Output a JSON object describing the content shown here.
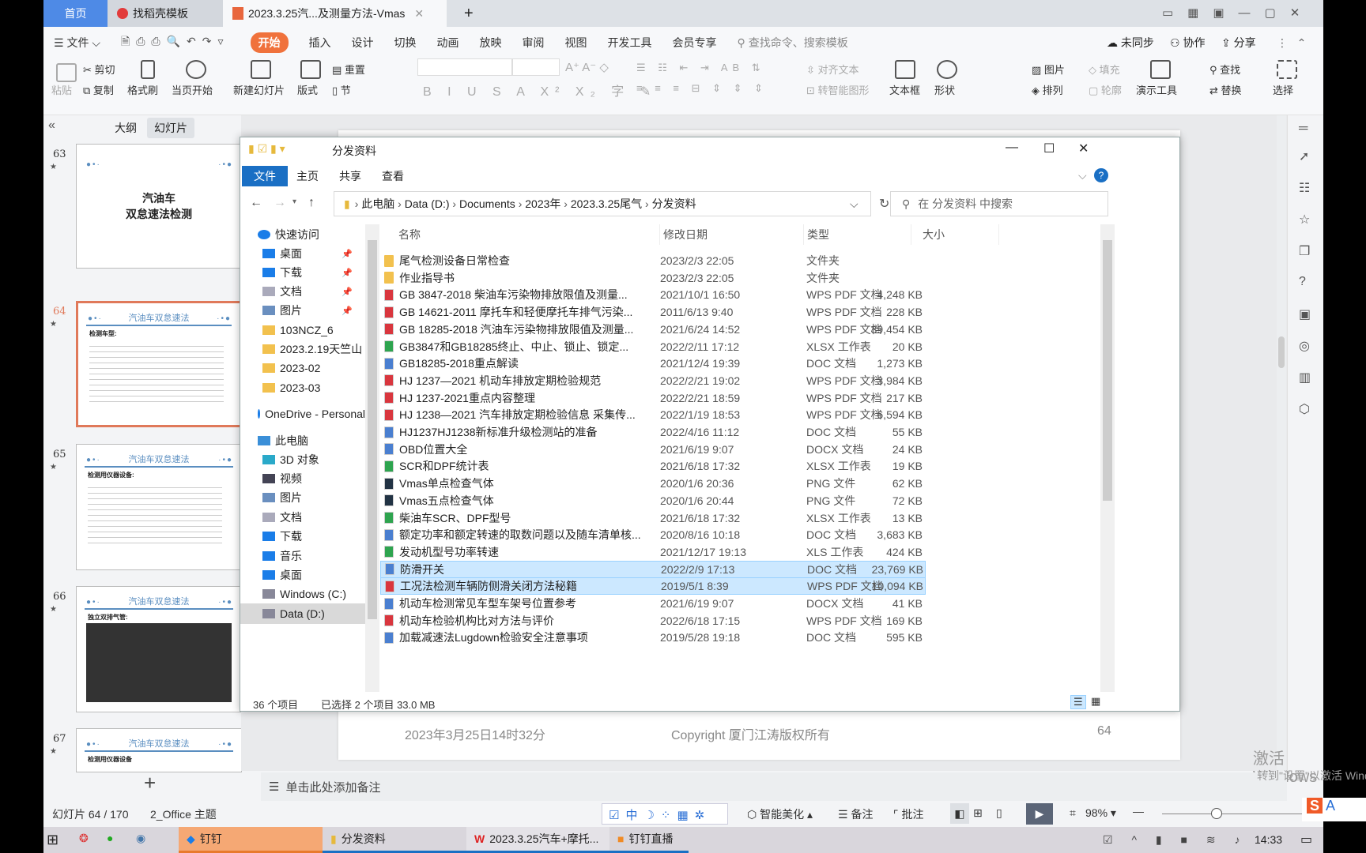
{
  "wps": {
    "tabs": [
      {
        "label": "首页"
      },
      {
        "label": "找稻壳模板"
      },
      {
        "label": "2023.3.25汽...及测量方法-Vmas"
      }
    ],
    "new_tab": "+",
    "menu": {
      "file": "文件",
      "items": [
        "开始",
        "插入",
        "设计",
        "切换",
        "动画",
        "放映",
        "审阅",
        "视图",
        "开发工具",
        "会员专享"
      ],
      "search": "查找命令、搜索模板",
      "sync": "未同步",
      "collab": "协作",
      "share": "分享"
    },
    "ribbon": {
      "paste": "粘贴",
      "cut": "剪切",
      "copy": "复制",
      "format_painter": "格式刷",
      "play_from_current": "当页开始",
      "new_slide": "新建幻灯片",
      "layout": "版式",
      "reset": "重置",
      "section": "节",
      "align_text": "对齐文本",
      "smart_graphic": "转智能图形",
      "textbox": "文本框",
      "shape": "形状",
      "picture": "图片",
      "arrange": "排列",
      "fill": "填充",
      "outline": "轮廓",
      "presenter_tools": "演示工具",
      "find": "查找",
      "replace": "替换",
      "select": "选择"
    },
    "panel": {
      "outline_tab": "大纲",
      "slides_tab": "幻灯片",
      "add": "+"
    },
    "thumbs": [
      {
        "num": "63",
        "title_line1": "汽油车",
        "title_line2": "双怠速法检测"
      },
      {
        "num": "64",
        "title": "汽油车双怠速法",
        "sub": "检测车型:"
      },
      {
        "num": "65",
        "title": "汽油车双怠速法",
        "sub": "检测用仪器设备:"
      },
      {
        "num": "66",
        "title": "汽油车双怠速法",
        "sub": "独立双排气管:"
      },
      {
        "num": "67",
        "title": "汽油车双怠速法",
        "sub": "检测用仪器设备"
      }
    ],
    "slide": {
      "date": "2023年3月25日14时32分",
      "copyright": "Copyright 厦门江涛版权所有",
      "page": "64"
    },
    "notes_placeholder": "单击此处添加备注",
    "status": {
      "slide_count": "幻灯片 64 / 170",
      "theme": "2_Office 主题",
      "beautify": "智能美化",
      "notes": "备注",
      "comments": "批注",
      "zoom": "98%"
    },
    "watermark": {
      "line1": "激活 Windows",
      "line2": "转到\"设置\"以激活 Windows。"
    }
  },
  "explorer": {
    "title": "分发资料",
    "tabs": [
      "文件",
      "主页",
      "共享",
      "查看"
    ],
    "breadcrumb": [
      "此电脑",
      "Data (D:)",
      "Documents",
      "2023年",
      "2023.3.25尾气",
      "分发资料"
    ],
    "search_placeholder": "在 分发资料 中搜索",
    "nav": [
      {
        "label": "快速访问",
        "icon": "star",
        "level": 0
      },
      {
        "label": "桌面",
        "icon": "desktop",
        "level": 1,
        "pinned": true
      },
      {
        "label": "下载",
        "icon": "download",
        "level": 1,
        "pinned": true
      },
      {
        "label": "文档",
        "icon": "document",
        "level": 1,
        "pinned": true
      },
      {
        "label": "图片",
        "icon": "picture",
        "level": 1,
        "pinned": true
      },
      {
        "label": "103NCZ_6",
        "icon": "folder",
        "level": 1
      },
      {
        "label": "2023.2.19天竺山",
        "icon": "folder",
        "level": 1
      },
      {
        "label": "2023-02",
        "icon": "folder",
        "level": 1
      },
      {
        "label": "2023-03",
        "icon": "folder",
        "level": 1
      },
      {
        "label": "OneDrive - Personal",
        "icon": "cloud",
        "level": 0
      },
      {
        "label": "此电脑",
        "icon": "computer",
        "level": 0
      },
      {
        "label": "3D 对象",
        "icon": "cube",
        "level": 1
      },
      {
        "label": "视频",
        "icon": "video",
        "level": 1
      },
      {
        "label": "图片",
        "icon": "picture",
        "level": 1
      },
      {
        "label": "文档",
        "icon": "document",
        "level": 1
      },
      {
        "label": "下载",
        "icon": "download",
        "level": 1
      },
      {
        "label": "音乐",
        "icon": "music",
        "level": 1
      },
      {
        "label": "桌面",
        "icon": "desktop",
        "level": 1
      },
      {
        "label": "Windows (C:)",
        "icon": "drive",
        "level": 1
      },
      {
        "label": "Data (D:)",
        "icon": "drive",
        "level": 1,
        "selected": true
      }
    ],
    "columns": [
      "名称",
      "修改日期",
      "类型",
      "大小"
    ],
    "files": [
      {
        "name": "尾气检测设备日常检查",
        "date": "2023/2/3 22:05",
        "type": "文件夹",
        "size": "",
        "kind": "folder"
      },
      {
        "name": "作业指导书",
        "date": "2023/2/3 22:05",
        "type": "文件夹",
        "size": "",
        "kind": "folder"
      },
      {
        "name": "GB 3847-2018 柴油车污染物排放限值及测量...",
        "date": "2021/10/1 16:50",
        "type": "WPS PDF 文档",
        "size": "4,248 KB",
        "kind": "pdf"
      },
      {
        "name": "GB 14621-2011 摩托车和轻便摩托车排气污染...",
        "date": "2011/6/13 9:40",
        "type": "WPS PDF 文档",
        "size": "228 KB",
        "kind": "pdf"
      },
      {
        "name": "GB 18285-2018 汽油车污染物排放限值及测量...",
        "date": "2021/6/24 14:52",
        "type": "WPS PDF 文档",
        "size": "39,454 KB",
        "kind": "pdf"
      },
      {
        "name": "GB3847和GB18285终止、中止、锁止、锁定...",
        "date": "2022/2/11 17:12",
        "type": "XLSX 工作表",
        "size": "20 KB",
        "kind": "xlsx"
      },
      {
        "name": "GB18285-2018重点解读",
        "date": "2021/12/4 19:39",
        "type": "DOC 文档",
        "size": "1,273 KB",
        "kind": "doc"
      },
      {
        "name": "HJ 1237—2021 机动车排放定期检验规范",
        "date": "2022/2/21 19:02",
        "type": "WPS PDF 文档",
        "size": "3,984 KB",
        "kind": "pdf"
      },
      {
        "name": "HJ 1237-2021重点内容整理",
        "date": "2022/2/21 18:59",
        "type": "WPS PDF 文档",
        "size": "217 KB",
        "kind": "pdf"
      },
      {
        "name": "HJ 1238—2021 汽车排放定期检验信息 采集传...",
        "date": "2022/1/19 18:53",
        "type": "WPS PDF 文档",
        "size": "6,594 KB",
        "kind": "pdf"
      },
      {
        "name": "HJ1237HJ1238新标准升级检测站的准备",
        "date": "2022/4/16 11:12",
        "type": "DOC 文档",
        "size": "55 KB",
        "kind": "doc"
      },
      {
        "name": "OBD位置大全",
        "date": "2021/6/19 9:07",
        "type": "DOCX 文档",
        "size": "24 KB",
        "kind": "docx"
      },
      {
        "name": "SCR和DPF统计表",
        "date": "2021/6/18 17:32",
        "type": "XLSX 工作表",
        "size": "19 KB",
        "kind": "xlsx"
      },
      {
        "name": "Vmas单点检查气体",
        "date": "2020/1/6 20:36",
        "type": "PNG 文件",
        "size": "62 KB",
        "kind": "png"
      },
      {
        "name": "Vmas五点检查气体",
        "date": "2020/1/6 20:44",
        "type": "PNG 文件",
        "size": "72 KB",
        "kind": "png"
      },
      {
        "name": "柴油车SCR、DPF型号",
        "date": "2021/6/18 17:32",
        "type": "XLSX 工作表",
        "size": "13 KB",
        "kind": "xlsx"
      },
      {
        "name": "额定功率和额定转速的取数问题以及随车清单核...",
        "date": "2020/8/16 10:18",
        "type": "DOC 文档",
        "size": "3,683 KB",
        "kind": "doc"
      },
      {
        "name": "发动机型号功率转速",
        "date": "2021/12/17 19:13",
        "type": "XLS 工作表",
        "size": "424 KB",
        "kind": "xlsx"
      },
      {
        "name": "防滑开关",
        "date": "2022/2/9 17:13",
        "type": "DOC 文档",
        "size": "23,769 KB",
        "kind": "doc",
        "selected": true
      },
      {
        "name": "工况法检测车辆防侧滑关闭方法秘籍",
        "date": "2019/5/1 8:39",
        "type": "WPS PDF 文档",
        "size": "10,094 KB",
        "kind": "pdf",
        "selected": true
      },
      {
        "name": "机动车检测常见车型车架号位置参考",
        "date": "2021/6/19 9:07",
        "type": "DOCX 文档",
        "size": "41 KB",
        "kind": "docx"
      },
      {
        "name": "机动车检验机构比对方法与评价",
        "date": "2022/6/18 17:15",
        "type": "WPS PDF 文档",
        "size": "169 KB",
        "kind": "pdf"
      },
      {
        "name": "加载减速法Lugdown检验安全注意事项",
        "date": "2019/5/28 19:18",
        "type": "DOC 文档",
        "size": "595 KB",
        "kind": "doc"
      }
    ],
    "status": {
      "count": "36 个项目",
      "selection": "已选择 2 个项目 33.0 MB"
    }
  },
  "taskbar": {
    "items": [
      "钉钉",
      "分发资料",
      "2023.3.25汽车+摩托...",
      "钉钉直播"
    ],
    "time": "14:33"
  },
  "colors": {
    "accent_orange": "#f0723c",
    "home_tab": "#4e8ae6",
    "explorer_blue": "#1a6fc4",
    "selection": "#cce8ff",
    "pdf": "#d9363e",
    "xlsx": "#2ea44f",
    "doc": "#4a7fd0",
    "folder": "#f2c14e",
    "slide_blue": "#5a8ec0"
  }
}
